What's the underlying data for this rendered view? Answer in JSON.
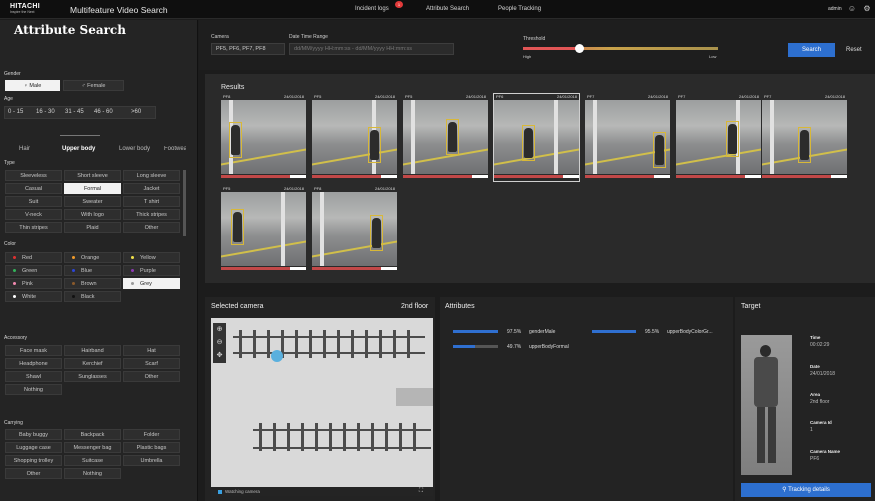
{
  "app": {
    "logo_brand": "HITACHI",
    "logo_tagline": "Inspire the Next",
    "title": "Multifeature Video Search",
    "user": "admin",
    "nav": [
      {
        "label": "Incident logs",
        "badge": "1"
      },
      {
        "label": "Attribute Search"
      },
      {
        "label": "People Tracking"
      }
    ]
  },
  "left": {
    "title": "Attribute Search",
    "gender_label": "Gender",
    "genders": [
      "Male",
      "Female"
    ],
    "gender_selected": "Male",
    "age_label": "Age",
    "ages": [
      "0 - 15",
      "16 - 30",
      "31 - 45",
      "46 - 60",
      ">60"
    ],
    "tabs": [
      "Hair",
      "Upper body",
      "Lower body",
      "Footwear"
    ],
    "tab_selected": "Upper body",
    "type_label": "Type",
    "types": [
      "Sleeveless",
      "Short sleeve",
      "Long sleeve",
      "Casual",
      "Formal",
      "Jacket",
      "Suit",
      "Sweater",
      "T shirt",
      "V-neck",
      "With logo",
      "Thick stripes",
      "Thin stripes",
      "Plaid",
      "Other"
    ],
    "type_selected": "Formal",
    "color_label": "Color",
    "colors": [
      {
        "name": "Red",
        "hex": "#e03030"
      },
      {
        "name": "Orange",
        "hex": "#f39c2a"
      },
      {
        "name": "Yellow",
        "hex": "#f2e14a"
      },
      {
        "name": "Green",
        "hex": "#33b35a"
      },
      {
        "name": "Blue",
        "hex": "#2d45d8"
      },
      {
        "name": "Purple",
        "hex": "#8e3ab5"
      },
      {
        "name": "Pink",
        "hex": "#f38ab0"
      },
      {
        "name": "Brown",
        "hex": "#8b5a2b"
      },
      {
        "name": "Grey",
        "hex": "#9a9a9a"
      },
      {
        "name": "White",
        "hex": "#ffffff"
      },
      {
        "name": "Black",
        "hex": "#111111"
      }
    ],
    "color_selected": "Grey",
    "accessory_label": "Accessory",
    "accessories": [
      "Face mask",
      "Hairband",
      "Hat",
      "Headphone",
      "Kerchief",
      "Scarf",
      "Shawl",
      "Sunglasses",
      "Other",
      "Nothing"
    ],
    "carrying_label": "Carrying",
    "carrying": [
      "Baby buggy",
      "Backpack",
      "Folder",
      "Luggage case",
      "Messenger bag",
      "Plastic bags",
      "Shopping trolley",
      "Suitcase",
      "Umbrella",
      "Other",
      "Nothing"
    ]
  },
  "header": {
    "camera_label": "Camera",
    "camera_value": "PF5, PF6, PF7, PF8",
    "dt_label": "Date Time Range",
    "dt_placeholder": "dd/MM/yyyy HH:mm:ss - dd/MM/yyyy HH:mm:ss",
    "threshold_label": "Threshold",
    "threshold_high": "High",
    "threshold_low": "Low",
    "threshold_value": 0.27,
    "search": "Search",
    "reset": "Reset"
  },
  "results": {
    "title": "Results",
    "items": [
      {
        "cam": "PF8",
        "date": "24/01/2018"
      },
      {
        "cam": "PF5",
        "date": "24/01/2018"
      },
      {
        "cam": "PF5",
        "date": "24/01/2018"
      },
      {
        "cam": "PF6",
        "date": "24/01/2018"
      },
      {
        "cam": "PF7",
        "date": "24/01/2018"
      },
      {
        "cam": "PF7",
        "date": "24/01/2018"
      },
      {
        "cam": "PF7",
        "date": "24/01/2018"
      },
      {
        "cam": "PF5",
        "date": "24/01/2018"
      },
      {
        "cam": "PF8",
        "date": "24/01/2018"
      }
    ]
  },
  "camera_panel": {
    "title": "Selected camera",
    "floor": "2nd floor",
    "footer": "Watching camera"
  },
  "attributes": {
    "title": "Attributes",
    "items": [
      {
        "pct": "97.5%",
        "name": "genderMale",
        "value": 0.975
      },
      {
        "pct": "95.5%",
        "name": "upperBodyColorGr...",
        "value": 0.955
      },
      {
        "pct": "49.7%",
        "name": "upperBodyFormal",
        "value": 0.497
      }
    ]
  },
  "target": {
    "title": "Target",
    "time_label": "Time",
    "time": "00:02:29",
    "date_label": "Date",
    "date": "24/01/2018",
    "area_label": "Area",
    "area": "2nd floor",
    "camid_label": "Camera Id",
    "camid": "1",
    "camname_label": "Camera Name",
    "camname": "PF6",
    "button": "Tracking details"
  }
}
